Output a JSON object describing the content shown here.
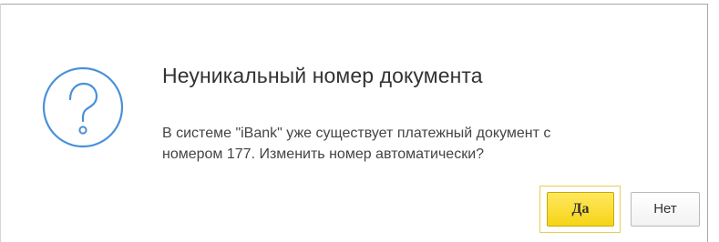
{
  "dialog": {
    "title": "Неуникальный номер документа",
    "message_lines": [
      "В системе \"iBank\" уже существует платежный документ с",
      "номером 177. Изменить номер автоматически?"
    ],
    "icon": "question-icon",
    "buttons": {
      "yes_label": "Да",
      "no_label": "Нет"
    }
  },
  "colors": {
    "icon_blue": "#4a90d9",
    "yes_button": "#f6d417",
    "yes_focus_frame": "#e7cf55",
    "border": "#a8a8a8"
  }
}
